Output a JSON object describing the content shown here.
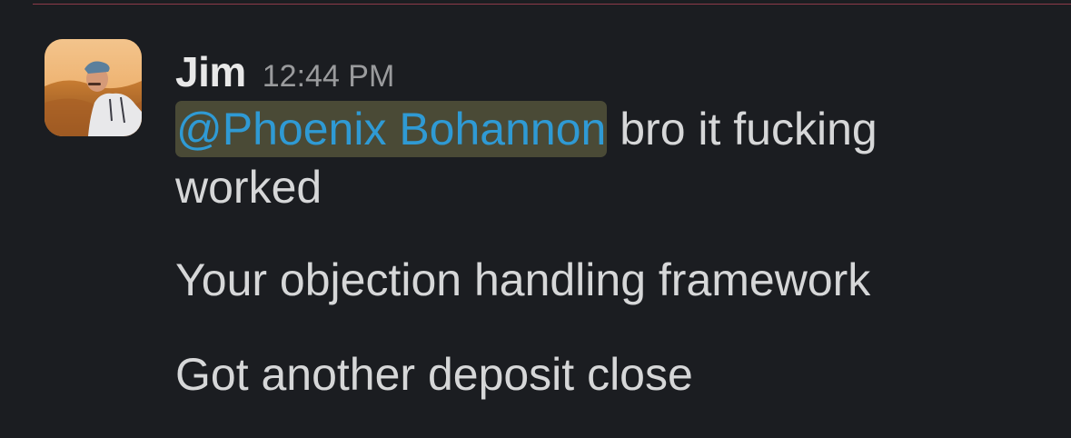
{
  "message": {
    "sender": "Jim",
    "timestamp": "12:44 PM",
    "mention": "@Phoenix Bohannon",
    "line1_rest": " bro it fucking",
    "line2": "worked",
    "paragraph2": "Your objection handling framework",
    "paragraph3": "Got another deposit close"
  },
  "colors": {
    "background": "#1b1d21",
    "mention_text": "#2f9ad4",
    "mention_highlight": "#4a4a36",
    "new_message_divider": "#8c3a4a"
  }
}
